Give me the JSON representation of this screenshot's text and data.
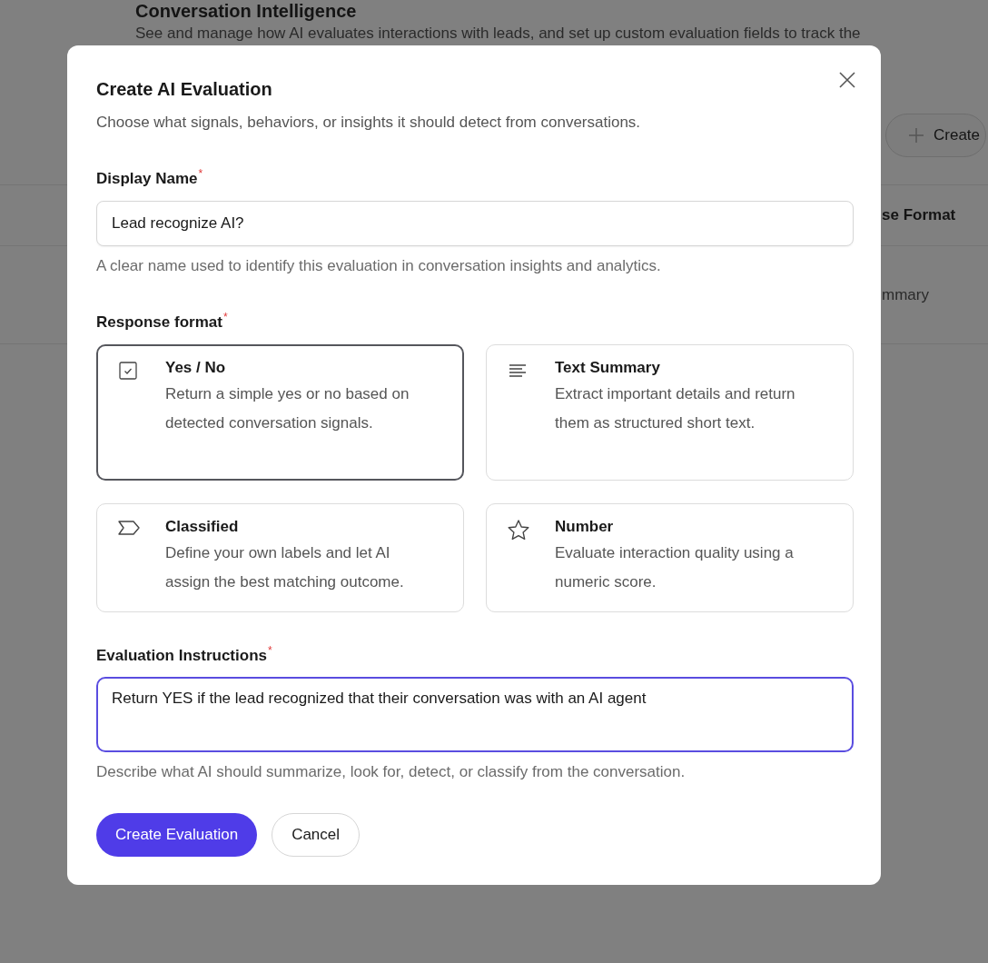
{
  "page": {
    "title": "Conversation Intelligence",
    "description": "See and manage how AI evaluates interactions with leads, and set up custom evaluation fields to track the",
    "create_button": "Create",
    "table": {
      "column_header": "se Format",
      "cell": "mmary"
    }
  },
  "dialog": {
    "title": "Create AI Evaluation",
    "subtitle": "Choose what signals, behaviors, or insights it should detect from conversations.",
    "display_name": {
      "label": "Display Name",
      "required_mark": "*",
      "value": "Lead recognize AI?",
      "help": "A clear name used to identify this evaluation in conversation insights and analytics."
    },
    "response_format": {
      "label": "Response format",
      "required_mark": "*",
      "options": [
        {
          "kind": "checkbox",
          "title": "Yes / No",
          "description": "Return a simple yes or no based on detected conversation signals.",
          "selected": true
        },
        {
          "kind": "lines",
          "title": "Text Summary",
          "description": "Extract important details and return them as structured short text.",
          "selected": false
        },
        {
          "kind": "tag",
          "title": "Classified",
          "description": "Define your own labels and let AI assign the best matching outcome.",
          "selected": false
        },
        {
          "kind": "star",
          "title": "Number",
          "description": "Evaluate interaction quality using a numeric score.",
          "selected": false
        }
      ]
    },
    "instructions": {
      "label": "Evaluation Instructions",
      "required_mark": "*",
      "value": "Return YES if the lead recognized that their conversation was with an AI agent",
      "focused": true,
      "help": "Describe what AI should summarize, look for, detect, or classify from the conversation."
    },
    "buttons": [
      {
        "kind": "primary",
        "label": "Create Evaluation"
      },
      {
        "kind": "secondary",
        "label": "Cancel"
      }
    ]
  }
}
